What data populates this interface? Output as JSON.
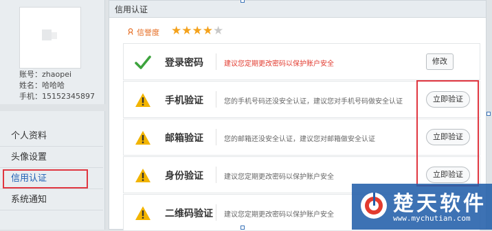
{
  "profile": {
    "account_line": "账号：zhaopei",
    "name_line": "姓名：哈哈哈",
    "phone_line": "手机：15152345897"
  },
  "menu": {
    "items": [
      {
        "label": "个人资料"
      },
      {
        "label": "头像设置"
      },
      {
        "label": "信用认证",
        "active": true
      },
      {
        "label": "系统通知"
      }
    ]
  },
  "panel": {
    "title": "信用认证",
    "reputation_label": "信誉度",
    "rating": {
      "value": 4,
      "max": 5
    }
  },
  "verifications": [
    {
      "name": "登录密码",
      "status": "ok",
      "icon": "check-icon",
      "description": "建议您定期更改密码以保护账户安全",
      "description_color": "#e23b2f",
      "action": "修改"
    },
    {
      "name": "手机验证",
      "status": "warning",
      "icon": "warning-icon",
      "description": "您的手机号码还没安全认证，建议您对手机号码做安全认证",
      "action": "立即验证"
    },
    {
      "name": "邮箱验证",
      "status": "warning",
      "icon": "warning-icon",
      "description": "您的邮箱还没安全认证，建议您对邮箱做安全认证",
      "action": "立即验证"
    },
    {
      "name": "身份验证",
      "status": "warning",
      "icon": "warning-icon",
      "description": "建议您定期更改密码以保护账户安全",
      "action": "立即验证"
    },
    {
      "name": "二维码验证",
      "status": "warning",
      "icon": "warning-icon",
      "description": "建议您定期更改密码以保护账户安全",
      "action": ""
    }
  ],
  "watermark": {
    "title": "楚天软件",
    "url": "www.mychutian.com"
  },
  "colors": {
    "accent": "#1e5fb4",
    "highlight": "#e0353f",
    "star": "#f4a21c",
    "warning": "#f2b400",
    "check": "#3da33d"
  }
}
